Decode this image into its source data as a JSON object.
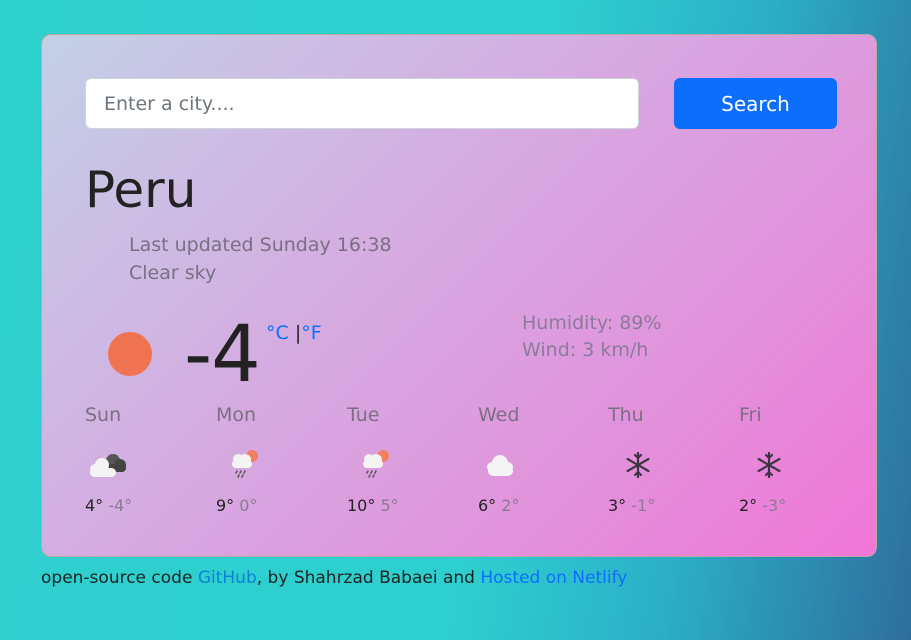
{
  "search": {
    "placeholder": "Enter a city....",
    "button_label": "Search"
  },
  "current": {
    "city": "Peru",
    "last_updated": "Last updated Sunday 16:38",
    "description": "Clear sky",
    "icon": "sun-icon",
    "temperature": "-4",
    "unit_celsius": "°C",
    "unit_separator": "|",
    "unit_fahrenheit": "°F",
    "humidity": "Humidity: 89%",
    "wind": "Wind: 3 km/h"
  },
  "forecast": [
    {
      "day": "Sun",
      "icon": "dark-cloud-icon",
      "max": "4°",
      "min": "-4°"
    },
    {
      "day": "Mon",
      "icon": "rain-sun-icon",
      "max": "9°",
      "min": "0°"
    },
    {
      "day": "Tue",
      "icon": "rain-sun-icon",
      "max": "10°",
      "min": "5°"
    },
    {
      "day": "Wed",
      "icon": "cloud-icon",
      "max": "6°",
      "min": "2°"
    },
    {
      "day": "Thu",
      "icon": "snowflake-icon",
      "max": "3°",
      "min": "-1°"
    },
    {
      "day": "Fri",
      "icon": "snowflake-icon",
      "max": "2°",
      "min": "-3°"
    }
  ],
  "footer": {
    "text_1": "open-source code ",
    "github_label": "GitHub",
    "text_2": ", by Shahrzad Babaei and ",
    "netlify_label": "Hosted on Netlify"
  },
  "colors": {
    "accent": "#0d6efd",
    "sun": "#ef7350"
  }
}
